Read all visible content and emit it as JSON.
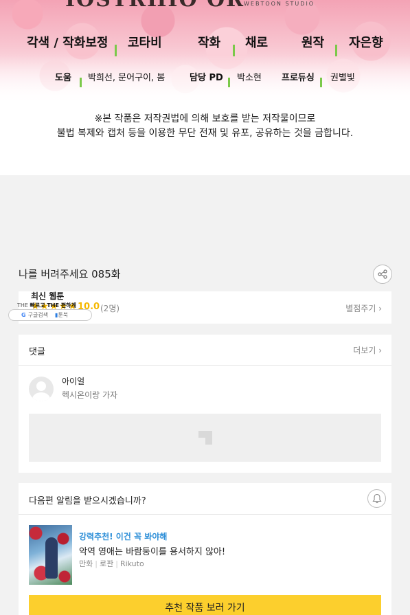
{
  "banner": {
    "logo_text": "IOSTRHIO OR",
    "studio_text": "WEBTOON STUDIO",
    "row1": {
      "a_label": "각색 / 작화보정",
      "a_value": "코타비",
      "b_label": "작화",
      "b_value": "채로",
      "c_label": "원작",
      "c_value": "자은향"
    },
    "row2": {
      "a_label": "도움",
      "a_value": "박희선, 문어구이, 봄",
      "b_label": "담당 PD",
      "b_value": "박소현",
      "c_label": "프로듀싱",
      "c_value": "권별빛"
    },
    "copyright_line1": "※본 작품은 저작권법에 의해 보호를 받는 저작물이므로",
    "copyright_line2": "불법 복제와 캡처 등을 이용한 무단 전재 및 유포, 공유하는 것을 금합니다."
  },
  "episode": {
    "title": "나를 버려주세요 085화",
    "share_icon": "share-icon"
  },
  "rating": {
    "stars": "★★★★★",
    "score": "10.0",
    "voters": "(2명)",
    "rate_link": "별점주기 ›",
    "star_color": "#f5b800"
  },
  "widget": {
    "title": "최신 웹툰",
    "sub_prefix": "THE",
    "sub_text": "빠르고 THE 편하게",
    "google_label": "G",
    "google_text": "구글검색",
    "book_text": "툰북"
  },
  "comments": {
    "title": "댓글",
    "more": "더보기 ›",
    "author": "아이얼",
    "text": "헥시온이랑 가자"
  },
  "next": {
    "title": "다음편 알림을 받으시겠습니까?",
    "rec_label": "강력추천! 이건 꼭 봐야해",
    "rec_title": "악역 영애는 바람둥이를 용서하지 않아!",
    "rec_meta_1": "만화",
    "rec_meta_2": "로판",
    "rec_meta_3": "Rikuto",
    "go_button": "추천 작품 보러 가기",
    "button_color": "#fccf2d",
    "label_color": "#2e8fd8"
  }
}
